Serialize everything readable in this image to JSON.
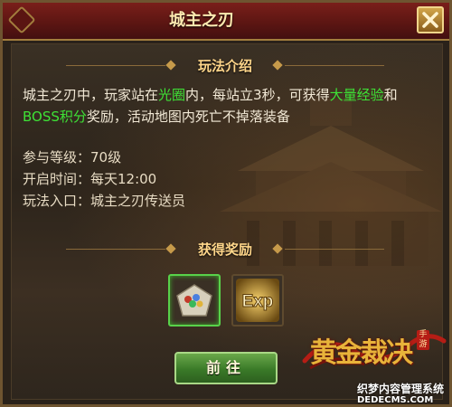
{
  "dialog": {
    "title": "城主之刃",
    "close_icon": "close-icon"
  },
  "intro": {
    "header": "玩法介绍",
    "desc_part1": "城主之刃中，玩家站在",
    "desc_hl1": "光圈",
    "desc_part2": "内，每站立3秒，可获得",
    "desc_hl2": "大量经验",
    "desc_part3": "和",
    "desc_hl3": "BOSS积分",
    "desc_part4": "奖励，活动地图内死亡不掉落装备",
    "level": "参与等级：70级",
    "time": "开启时间：每天12:00",
    "entry": "玩法入口：城主之刃传送员"
  },
  "rewards": {
    "header": "获得奖励",
    "items": [
      {
        "icon": "gem-bundle-icon"
      },
      {
        "label": "Exp",
        "icon": "exp-icon"
      }
    ]
  },
  "actions": {
    "go_label": "前往"
  },
  "branding": {
    "logo_text": "黄金裁决",
    "logo_tag": "手游",
    "watermark_cn": "织梦内容管理系统",
    "watermark_url": "DEDECMS.COM"
  },
  "colors": {
    "title_bar": "#5a1512",
    "highlight_green": "#3ee236",
    "header_gold": "#ffd68a",
    "go_button": "#3a7a28"
  }
}
